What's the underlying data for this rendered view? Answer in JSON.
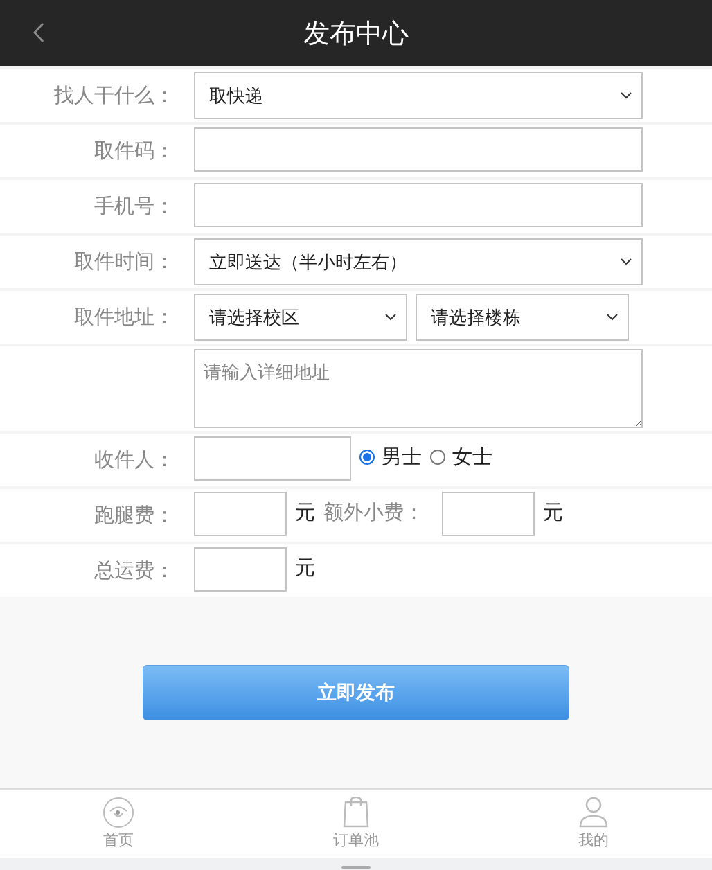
{
  "header": {
    "title": "发布中心"
  },
  "rows": [
    {
      "label": "找人干什么：",
      "controls": [
        {
          "kind": "select",
          "value": "取快递"
        }
      ]
    },
    {
      "label": "取件码：",
      "controls": [
        {
          "kind": "input"
        }
      ]
    },
    {
      "label": "手机号：",
      "controls": [
        {
          "kind": "input"
        }
      ]
    },
    {
      "label": "取件时间：",
      "controls": [
        {
          "kind": "select",
          "value": "立即送达（半小时左右）"
        }
      ]
    },
    {
      "label": "取件地址：",
      "controls": [
        {
          "kind": "select",
          "value": "请选择校区"
        },
        {
          "kind": "select",
          "value": "请选择楼栋"
        }
      ]
    },
    {
      "controls": [
        {
          "kind": "textarea",
          "placeholder": "请输入详细地址"
        }
      ]
    },
    {
      "label": "收件人：",
      "controls": [
        {
          "kind": "input"
        },
        {
          "kind": "radio",
          "text": "男士",
          "selected": true
        },
        {
          "kind": "radio",
          "text": "女士",
          "selected": false
        }
      ]
    },
    {
      "label": "跑腿费：",
      "controls": [
        {
          "kind": "input"
        },
        {
          "kind": "unit",
          "text": "元"
        },
        {
          "kind": "label",
          "text": "额外小费："
        },
        {
          "kind": "input"
        },
        {
          "kind": "unit",
          "text": "元"
        }
      ]
    },
    {
      "label": "总运费：",
      "controls": [
        {
          "kind": "input"
        },
        {
          "kind": "unit",
          "text": "元"
        }
      ]
    }
  ],
  "submit": "立即发布",
  "tabbar": [
    {
      "label": "首页"
    },
    {
      "label": "订单池"
    },
    {
      "label": "我的"
    }
  ]
}
